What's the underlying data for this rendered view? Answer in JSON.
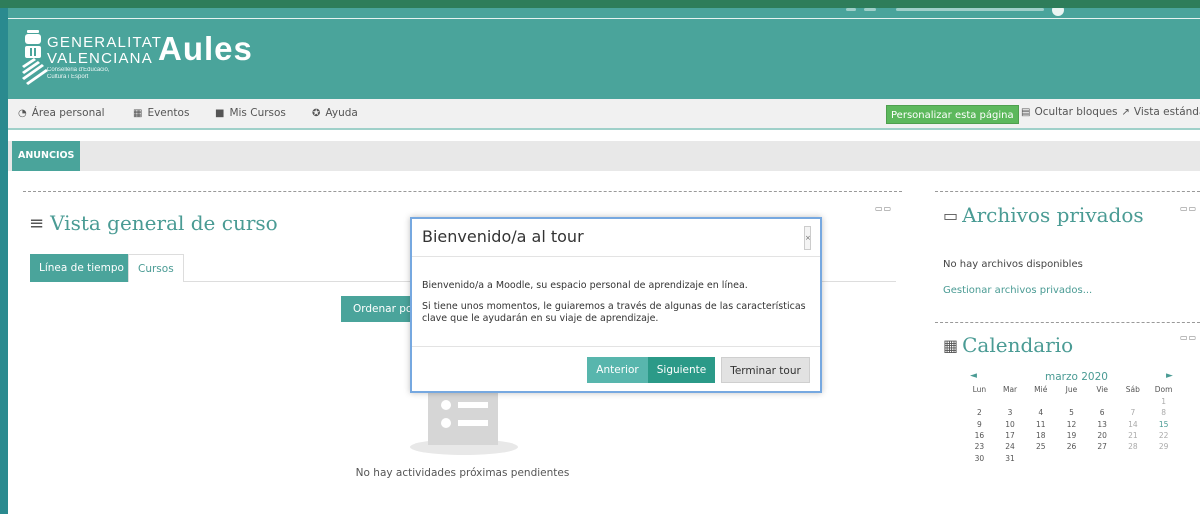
{
  "colors": {
    "header_teal": "#4aa49b",
    "accent_teal": "#4a9b94",
    "personalize_green": "#5cb85c",
    "modal_border": "#76a8e0",
    "outer_green": "#2e7d5a"
  },
  "header": {
    "org_line1": "GENERALITAT",
    "org_line2": "VALENCIANA",
    "org_sub1": "Conselleria d'Educació,",
    "org_sub2": "Cultura i Esport",
    "brand": "Aules"
  },
  "nav": {
    "items": [
      {
        "label": "Área personal",
        "icon": "dashboard-icon"
      },
      {
        "label": "Eventos",
        "icon": "calendar-icon"
      },
      {
        "label": "Mis Cursos",
        "icon": "briefcase-icon"
      },
      {
        "label": "Ayuda",
        "icon": "help-icon"
      }
    ],
    "personalize_label": "Personalizar esta página",
    "hide_blocks_label": "Ocultar bloques",
    "standard_view_label": "Vista estándar"
  },
  "tabs": {
    "announcements": "ANUNCIOS"
  },
  "main": {
    "title": "Vista general de curso",
    "tab_timeline": "Línea de tiempo",
    "tab_courses": "Cursos",
    "sort_button": "Ordenar por fechas",
    "empty_text": "No hay actividades próximas pendientes"
  },
  "private_files": {
    "title": "Archivos privados",
    "empty": "No hay archivos disponibles",
    "manage_link": "Gestionar archivos privados..."
  },
  "calendar": {
    "title": "Calendario",
    "month": "marzo 2020",
    "prev": "◄",
    "next": "►",
    "weekdays": [
      "Lun",
      "Mar",
      "Mié",
      "Jue",
      "Vie",
      "Sáb",
      "Dom"
    ],
    "weeks": [
      [
        "",
        "",
        "",
        "",
        "",
        "",
        "1"
      ],
      [
        "2",
        "3",
        "4",
        "5",
        "6",
        "7",
        "8"
      ],
      [
        "9",
        "10",
        "11",
        "12",
        "13",
        "14",
        "15"
      ],
      [
        "16",
        "17",
        "18",
        "19",
        "20",
        "21",
        "22"
      ],
      [
        "23",
        "24",
        "25",
        "26",
        "27",
        "28",
        "29"
      ],
      [
        "30",
        "31",
        "",
        "",
        "",
        "",
        ""
      ]
    ],
    "today": "15"
  },
  "tour": {
    "title": "Bienvenido/a al tour",
    "close": "×",
    "paragraph1": "Bienvenido/a a Moodle, su espacio personal de aprendizaje en línea.",
    "paragraph2": "Si tiene unos momentos, le guiaremos a través de algunas de las características clave que le ayudarán en su viaje de aprendizaje.",
    "prev_label": "Anterior",
    "next_label": "Siguiente",
    "end_label": "Terminar tour"
  }
}
